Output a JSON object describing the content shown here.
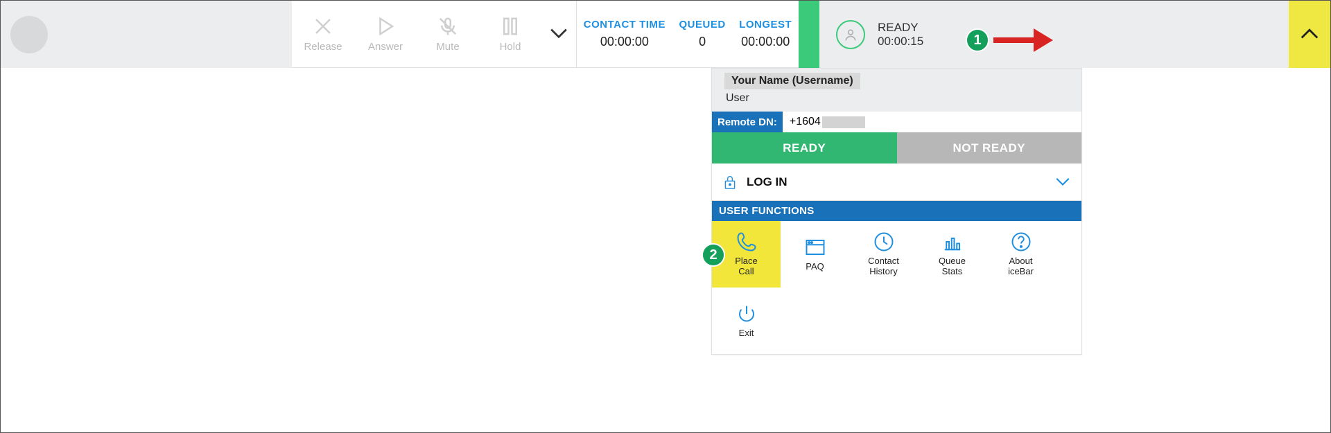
{
  "callControls": {
    "release": "Release",
    "answer": "Answer",
    "mute": "Mute",
    "hold": "Hold"
  },
  "stats": {
    "contactTime": {
      "label": "CONTACT TIME",
      "value": "00:00:00"
    },
    "queued": {
      "label": "QUEUED",
      "value": "0"
    },
    "longest": {
      "label": "LONGEST",
      "value": "00:00:00"
    }
  },
  "status": {
    "state": "READY",
    "time": "00:00:15"
  },
  "callouts": {
    "one": "1",
    "two": "2"
  },
  "panel": {
    "name": "Your Name (Username)",
    "role": "User",
    "remoteDnLabel": "Remote DN:",
    "remoteDnValue": "+1604",
    "readyLabel": "READY",
    "notReadyLabel": "NOT READY",
    "loginLabel": "LOG IN",
    "ufHeader": "USER FUNCTIONS",
    "ufItems": [
      {
        "label": "Place\nCall",
        "icon": "phone",
        "hl": true
      },
      {
        "label": "PAQ",
        "icon": "window",
        "hl": false
      },
      {
        "label": "Contact\nHistory",
        "icon": "clock",
        "hl": false
      },
      {
        "label": "Queue\nStats",
        "icon": "bars",
        "hl": false
      },
      {
        "label": "About\niceBar",
        "icon": "question",
        "hl": false
      },
      {
        "label": "Exit",
        "icon": "power",
        "hl": false
      }
    ]
  }
}
